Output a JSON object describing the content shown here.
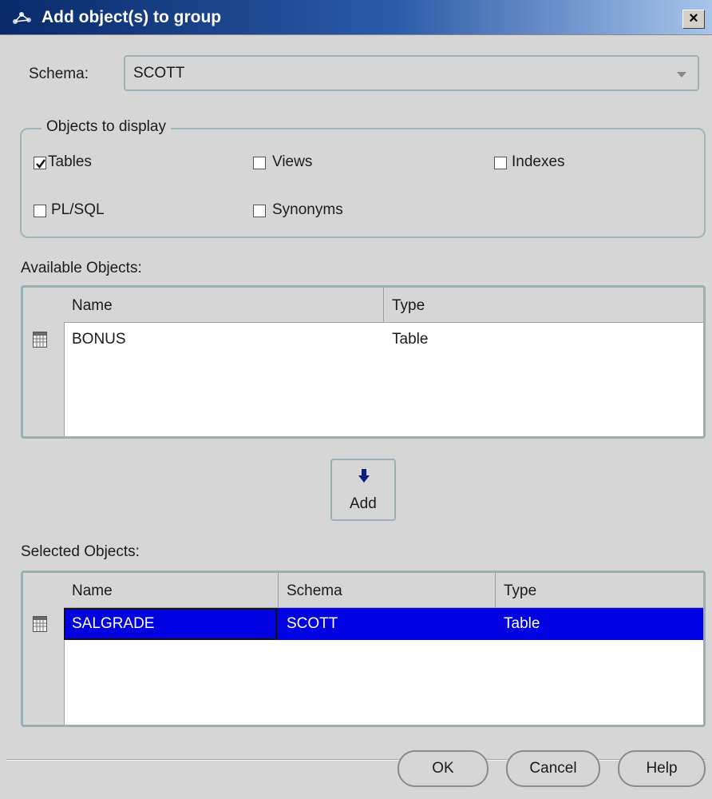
{
  "window": {
    "title": "Add object(s) to group",
    "close_symbol": "×"
  },
  "schema": {
    "label": "Schema:",
    "value": "SCOTT"
  },
  "objects_to_display": {
    "legend": "Objects to display",
    "options": [
      {
        "label": "Tables",
        "checked": true
      },
      {
        "label": "Views",
        "checked": false
      },
      {
        "label": "Indexes",
        "checked": false
      },
      {
        "label": "PL/SQL",
        "checked": false
      },
      {
        "label": "Synonyms",
        "checked": false
      }
    ]
  },
  "available": {
    "label": "Available Objects:",
    "columns": [
      "Name",
      "Type"
    ],
    "rows": [
      {
        "name": "BONUS",
        "type": "Table"
      }
    ]
  },
  "add_button": {
    "label": "Add"
  },
  "selected": {
    "label": "Selected Objects:",
    "columns": [
      "Name",
      "Schema",
      "Type"
    ],
    "rows": [
      {
        "name": "SALGRADE",
        "schema": "SCOTT",
        "type": "Table",
        "selected": true
      }
    ]
  },
  "buttons": {
    "ok": "OK",
    "cancel": "Cancel",
    "help": "Help"
  },
  "colors": {
    "selection": "#0000e0",
    "title_start": "#082a6b",
    "title_end": "#a8c4ea"
  }
}
